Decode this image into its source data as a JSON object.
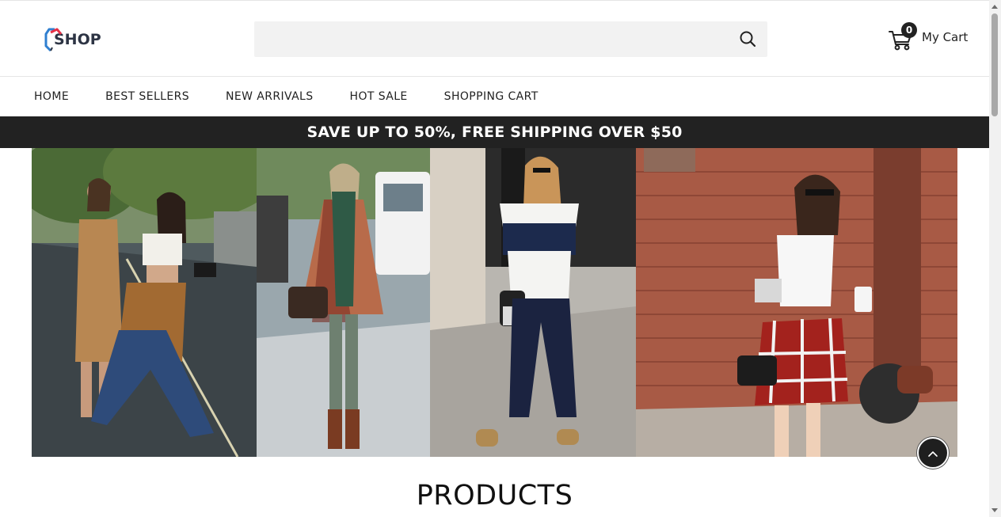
{
  "header": {
    "logo_text": "SHOP",
    "search": {
      "placeholder": "",
      "value": "",
      "icon": "search-icon"
    },
    "cart": {
      "count": "0",
      "label": "My Cart",
      "icon": "cart-icon"
    }
  },
  "nav": {
    "items": [
      {
        "label": "HOME"
      },
      {
        "label": "BEST SELLERS"
      },
      {
        "label": "NEW ARRIVALS"
      },
      {
        "label": "HOT SALE"
      },
      {
        "label": "SHOPPING CART"
      }
    ]
  },
  "promo": {
    "text": "SAVE UP TO 50%, FREE SHIPPING OVER $50"
  },
  "main": {
    "section_title": "PRODUCTS"
  },
  "colors": {
    "promo_bg": "#222222",
    "search_bg": "#f2f2f2",
    "logo_red": "#e63146",
    "logo_blue": "#2f7fd0"
  }
}
